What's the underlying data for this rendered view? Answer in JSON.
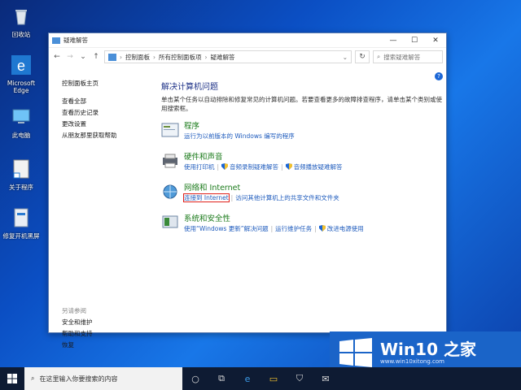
{
  "desktop": {
    "icons": [
      {
        "label": "回收站",
        "icon": "recycle-bin-icon"
      },
      {
        "label": "Microsoft Edge",
        "icon": "edge-icon"
      },
      {
        "label": "此电脑",
        "icon": "computer-icon"
      },
      {
        "label": "关于程序",
        "icon": "shortcut-icon"
      },
      {
        "label": "修复开机黑屏",
        "icon": "repair-icon"
      }
    ]
  },
  "window": {
    "title": "疑难解答",
    "address": {
      "crumbs": [
        "控制面板",
        "所有控制面板项",
        "疑难解答"
      ]
    },
    "search_placeholder": "搜索疑难解答",
    "left_nav": {
      "home": "控制面板主页",
      "items": [
        "查看全部",
        "查看历史记录",
        "更改设置",
        "从朋友那里获取帮助"
      ]
    },
    "see_also": {
      "header": "另请参阅",
      "items": [
        "安全和维护",
        "帮助和支持",
        "恢复"
      ]
    },
    "main": {
      "heading": "解决计算机问题",
      "description": "单击某个任务以自动排除和修复常见的计算机问题。若要查看更多的故障排查程序，请单击某个类别或使用搜索框。",
      "categories": [
        {
          "title": "程序",
          "links": [
            "运行为以前版本的 Windows 编写的程序"
          ]
        },
        {
          "title": "硬件和声音",
          "links": [
            "使用打印机",
            "音频录制疑难解答",
            "音频播放疑难解答"
          ]
        },
        {
          "title": "网络和 Internet",
          "links": [
            "连接到 Internet",
            "访问其他计算机上的共享文件和文件夹"
          ]
        },
        {
          "title": "系统和安全性",
          "links": [
            "使用“Windows 更新”解决问题",
            "运行维护任务",
            "改进电源使用"
          ]
        }
      ]
    }
  },
  "taskbar": {
    "search_placeholder": "在这里输入你要搜索的内容"
  },
  "watermark": {
    "brand": "Win10 之家",
    "url": "www.win10xitong.com"
  },
  "colors": {
    "link": "#1e5bbd",
    "category_title": "#1a7a1a",
    "heading": "#1e3287",
    "highlight": "#e0201a"
  }
}
